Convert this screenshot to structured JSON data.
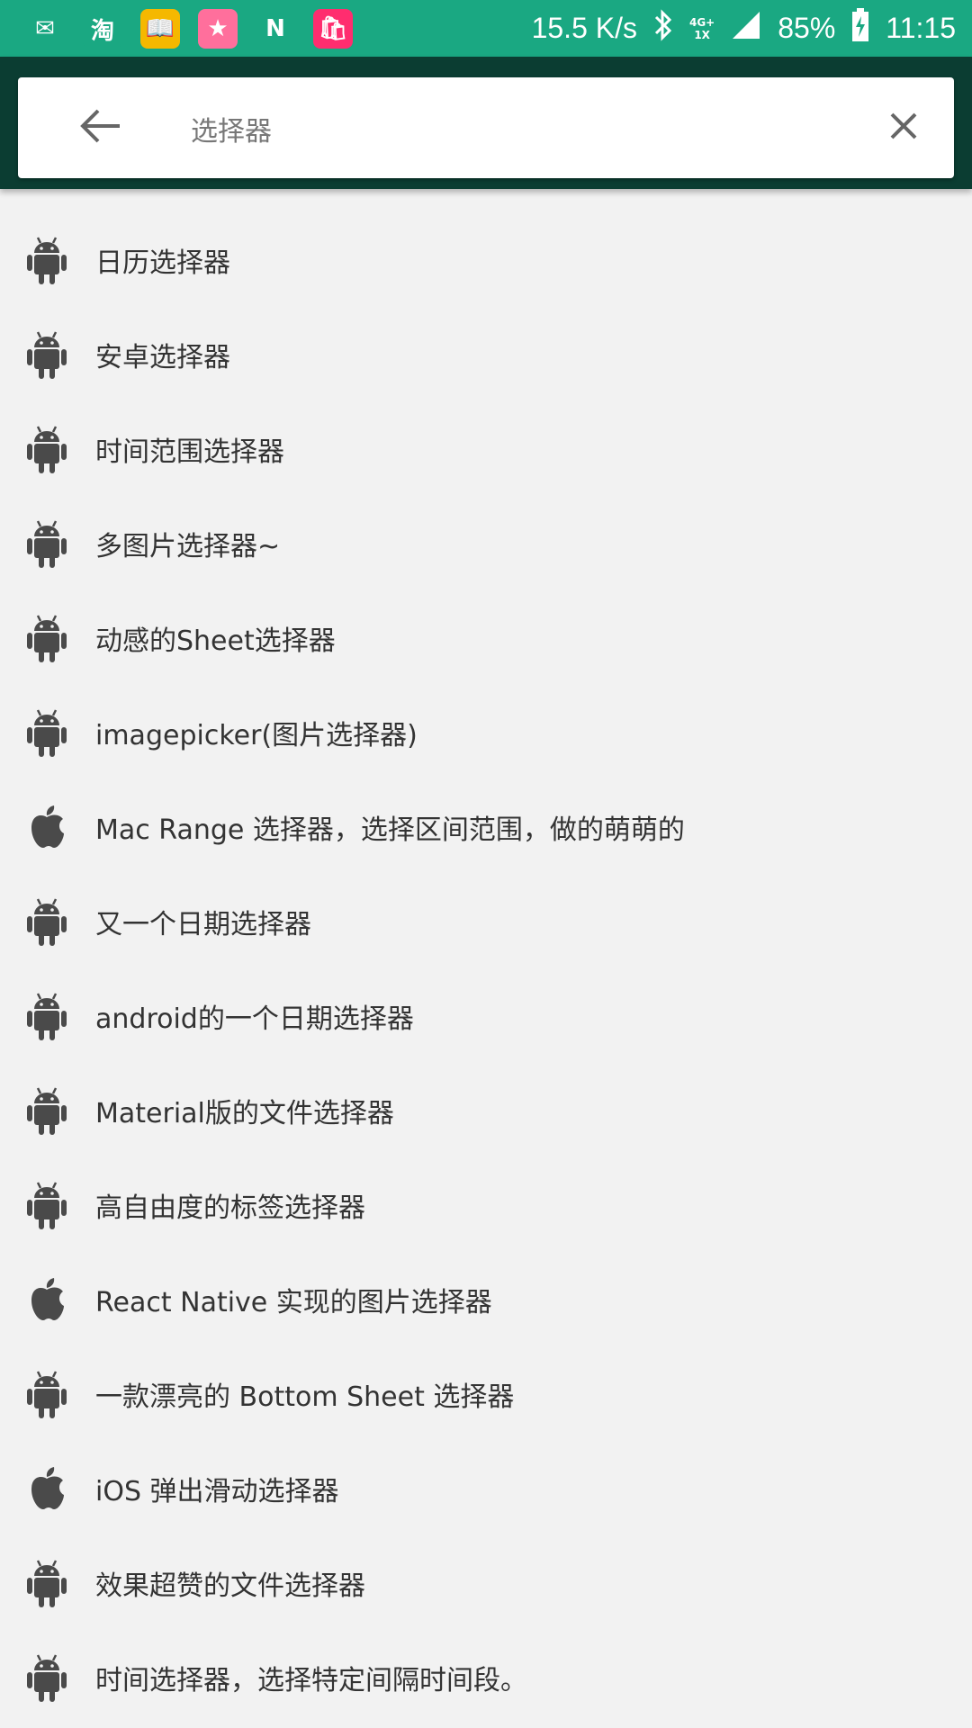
{
  "status_bar": {
    "app_icons": [
      {
        "name": "mail-icon",
        "bg": "#1aa882",
        "glyph": "✉"
      },
      {
        "name": "taobao-icon",
        "bg": "#1aa882",
        "glyph": "淘"
      },
      {
        "name": "book-app-icon",
        "bg": "#f5b800",
        "glyph": "📖"
      },
      {
        "name": "star-app-icon",
        "bg": "#ff6f9c",
        "glyph": "★"
      },
      {
        "name": "n-app-icon",
        "bg": "#1aa882",
        "glyph": "N"
      },
      {
        "name": "shopping-bag-icon",
        "bg": "#ff2d6f",
        "glyph": "🛍"
      }
    ],
    "network_speed": "15.5 K/s",
    "network_type_top": "4G+",
    "network_type_bottom": "1X",
    "battery": "85%",
    "time": "11:15"
  },
  "search": {
    "query": "选择器"
  },
  "results": [
    {
      "label": "日历选择器",
      "platform": "android"
    },
    {
      "label": "安卓选择器",
      "platform": "android"
    },
    {
      "label": "时间范围选择器",
      "platform": "android"
    },
    {
      "label": "多图片选择器~",
      "platform": "android"
    },
    {
      "label": "动感的Sheet选择器",
      "platform": "android"
    },
    {
      "label": "imagepicker(图片选择器)",
      "platform": "android"
    },
    {
      "label": "Mac Range 选择器，选择区间范围，做的萌萌的",
      "platform": "apple"
    },
    {
      "label": "又一个日期选择器",
      "platform": "android"
    },
    {
      "label": "android的一个日期选择器",
      "platform": "android"
    },
    {
      "label": "Material版的文件选择器",
      "platform": "android"
    },
    {
      "label": "高自由度的标签选择器",
      "platform": "android"
    },
    {
      "label": "React Native 实现的图片选择器",
      "platform": "apple"
    },
    {
      "label": "一款漂亮的 Bottom Sheet 选择器",
      "platform": "android"
    },
    {
      "label": "iOS 弹出滑动选择器",
      "platform": "apple"
    },
    {
      "label": "效果超赞的文件选择器",
      "platform": "android"
    },
    {
      "label": "时间选择器，选择特定间隔时间段。",
      "platform": "android"
    }
  ],
  "colors": {
    "status_bar": "#1aa882",
    "header": "#0b3d32",
    "background": "#f2f2f2",
    "icon": "#4a4a4a",
    "text": "#333333"
  }
}
